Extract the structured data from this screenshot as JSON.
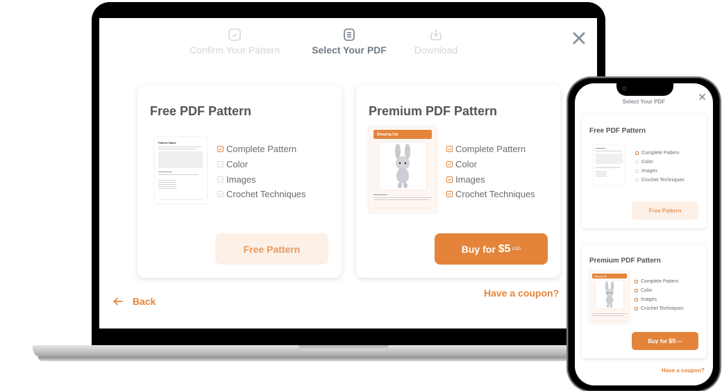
{
  "stepper": {
    "steps": [
      {
        "label": "Confirm Your Pattern",
        "icon": "check-square-icon",
        "state": "inactive"
      },
      {
        "label": "Select Your PDF",
        "icon": "document-icon",
        "state": "active"
      },
      {
        "label": "Download",
        "icon": "download-icon",
        "state": "inactive"
      }
    ]
  },
  "close_icon": "close-icon",
  "colors": {
    "accent": "#e3843a",
    "accent_light": "#fdf0e7",
    "title_gray": "#555555",
    "step_active": "#707a85",
    "step_inactive": "#d6d6d6"
  },
  "cards": {
    "free": {
      "title": "Free PDF Pattern",
      "thumbnail": {
        "doc_title": "Pattern Name"
      },
      "features": [
        {
          "label": "Complete Pattern",
          "included": true
        },
        {
          "label": "Color",
          "included": false
        },
        {
          "label": "Images",
          "included": false
        },
        {
          "label": "Crochet Techniques",
          "included": false
        }
      ],
      "button_label": "Free Pattern"
    },
    "premium": {
      "title": "Premium PDF Pattern",
      "thumbnail": {
        "doc_title": "Sleeping Cat"
      },
      "features": [
        {
          "label": "Complete Pattern",
          "included": true
        },
        {
          "label": "Color",
          "included": true
        },
        {
          "label": "Images",
          "included": true
        },
        {
          "label": "Crochet Techniques",
          "included": true
        }
      ],
      "button_prefix": "Buy for",
      "price": "$5",
      "currency": "USD"
    }
  },
  "footer": {
    "back_label": "Back",
    "coupon_label": "Have a coupon?"
  },
  "mobile": {
    "title": "Select Your PDF"
  }
}
